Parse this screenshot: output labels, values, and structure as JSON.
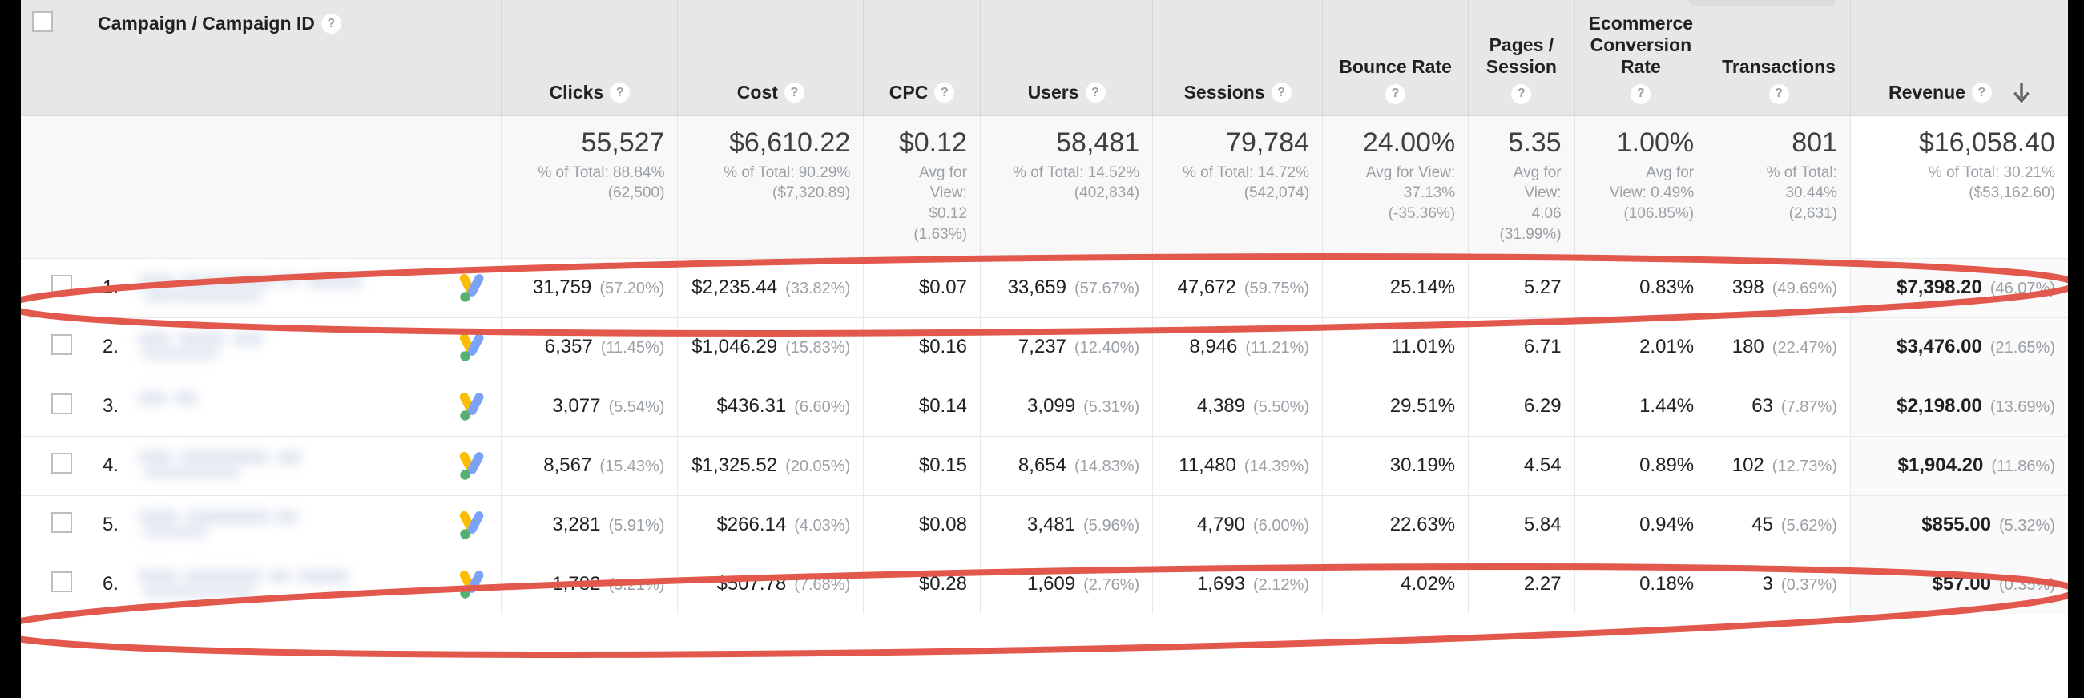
{
  "table": {
    "dimension_header": "Campaign / Campaign ID",
    "help_glyph": "?",
    "sort_arrow_name": "descending-sort-arrow",
    "columns": [
      {
        "key": "clicks",
        "label": "Clicks",
        "help": "?"
      },
      {
        "key": "cost",
        "label": "Cost",
        "help": "?"
      },
      {
        "key": "cpc",
        "label": "CPC",
        "help": "?"
      },
      {
        "key": "users",
        "label": "Users",
        "help": "?"
      },
      {
        "key": "sessions",
        "label": "Sessions",
        "help": "?"
      },
      {
        "key": "bounce",
        "label": "Bounce Rate",
        "help": "?"
      },
      {
        "key": "pages",
        "label": "Pages /\nSession",
        "help": "?"
      },
      {
        "key": "ecom",
        "label": "Ecommerce\nConversion\nRate",
        "help": "?"
      },
      {
        "key": "trans",
        "label": "Transactions",
        "help": "?"
      },
      {
        "key": "revenue",
        "label": "Revenue",
        "help": "?"
      }
    ],
    "summary": {
      "clicks": {
        "value": "55,527",
        "sub": "% of Total: 88.84%\n(62,500)"
      },
      "cost": {
        "value": "$6,610.22",
        "sub": "% of Total: 90.29%\n($7,320.89)"
      },
      "cpc": {
        "value": "$0.12",
        "sub": "Avg for\nView:\n$0.12\n(1.63%)"
      },
      "users": {
        "value": "58,481",
        "sub": "% of Total: 14.52%\n(402,834)"
      },
      "sessions": {
        "value": "79,784",
        "sub": "% of Total: 14.72%\n(542,074)"
      },
      "bounce": {
        "value": "24.00%",
        "sub": "Avg for View:\n37.13%\n(-35.36%)"
      },
      "pages": {
        "value": "5.35",
        "sub": "Avg for\nView:\n4.06\n(31.99%)"
      },
      "ecom": {
        "value": "1.00%",
        "sub": "Avg for\nView: 0.49%\n(106.85%)"
      },
      "trans": {
        "value": "801",
        "sub": "% of Total:\n30.44%\n(2,631)"
      },
      "revenue": {
        "value": "$16,058.40",
        "sub": "% of Total: 30.21%\n($53,162.60)"
      }
    },
    "rows": [
      {
        "index": "1.",
        "campaign_name_redacted": true,
        "clicks": "31,759",
        "clicks_pct": "(57.20%)",
        "cost": "$2,235.44",
        "cost_pct": "(33.82%)",
        "cpc": "$0.07",
        "cpc_pct": "",
        "users": "33,659",
        "users_pct": "(57.67%)",
        "sessions": "47,672",
        "sessions_pct": "(59.75%)",
        "bounce": "25.14%",
        "bounce_pct": "",
        "pages": "5.27",
        "pages_pct": "",
        "ecom": "0.83%",
        "ecom_pct": "",
        "trans": "398",
        "trans_pct": "(49.69%)",
        "revenue": "$7,398.20",
        "revenue_pct": "(46.07%)"
      },
      {
        "index": "2.",
        "campaign_name_redacted": true,
        "clicks": "6,357",
        "clicks_pct": "(11.45%)",
        "cost": "$1,046.29",
        "cost_pct": "(15.83%)",
        "cpc": "$0.16",
        "cpc_pct": "",
        "users": "7,237",
        "users_pct": "(12.40%)",
        "sessions": "8,946",
        "sessions_pct": "(11.21%)",
        "bounce": "11.01%",
        "bounce_pct": "",
        "pages": "6.71",
        "pages_pct": "",
        "ecom": "2.01%",
        "ecom_pct": "",
        "trans": "180",
        "trans_pct": "(22.47%)",
        "revenue": "$3,476.00",
        "revenue_pct": "(21.65%)"
      },
      {
        "index": "3.",
        "campaign_name_redacted": true,
        "clicks": "3,077",
        "clicks_pct": "(5.54%)",
        "cost": "$436.31",
        "cost_pct": "(6.60%)",
        "cpc": "$0.14",
        "cpc_pct": "",
        "users": "3,099",
        "users_pct": "(5.31%)",
        "sessions": "4,389",
        "sessions_pct": "(5.50%)",
        "bounce": "29.51%",
        "bounce_pct": "",
        "pages": "6.29",
        "pages_pct": "",
        "ecom": "1.44%",
        "ecom_pct": "",
        "trans": "63",
        "trans_pct": "(7.87%)",
        "revenue": "$2,198.00",
        "revenue_pct": "(13.69%)"
      },
      {
        "index": "4.",
        "campaign_name_redacted": true,
        "clicks": "8,567",
        "clicks_pct": "(15.43%)",
        "cost": "$1,325.52",
        "cost_pct": "(20.05%)",
        "cpc": "$0.15",
        "cpc_pct": "",
        "users": "8,654",
        "users_pct": "(14.83%)",
        "sessions": "11,480",
        "sessions_pct": "(14.39%)",
        "bounce": "30.19%",
        "bounce_pct": "",
        "pages": "4.54",
        "pages_pct": "",
        "ecom": "0.89%",
        "ecom_pct": "",
        "trans": "102",
        "trans_pct": "(12.73%)",
        "revenue": "$1,904.20",
        "revenue_pct": "(11.86%)"
      },
      {
        "index": "5.",
        "campaign_name_redacted": true,
        "clicks": "3,281",
        "clicks_pct": "(5.91%)",
        "cost": "$266.14",
        "cost_pct": "(4.03%)",
        "cpc": "$0.08",
        "cpc_pct": "",
        "users": "3,481",
        "users_pct": "(5.96%)",
        "sessions": "4,790",
        "sessions_pct": "(6.00%)",
        "bounce": "22.63%",
        "bounce_pct": "",
        "pages": "5.84",
        "pages_pct": "",
        "ecom": "0.94%",
        "ecom_pct": "",
        "trans": "45",
        "trans_pct": "(5.62%)",
        "revenue": "$855.00",
        "revenue_pct": "(5.32%)"
      },
      {
        "index": "6.",
        "campaign_name_redacted": true,
        "clicks": "1,782",
        "clicks_pct": "(3.21%)",
        "cost": "$507.78",
        "cost_pct": "(7.68%)",
        "cpc": "$0.28",
        "cpc_pct": "",
        "users": "1,609",
        "users_pct": "(2.76%)",
        "sessions": "1,693",
        "sessions_pct": "(2.12%)",
        "bounce": "4.02%",
        "bounce_pct": "",
        "pages": "2.27",
        "pages_pct": "",
        "ecom": "0.18%",
        "ecom_pct": "",
        "trans": "3",
        "trans_pct": "(0.37%)",
        "revenue": "$57.00",
        "revenue_pct": "(0.35%)"
      }
    ]
  },
  "annotations": {
    "color": "#e2584d",
    "shapes": [
      {
        "name": "highlight-ellipse-row-1",
        "target_row": "1."
      },
      {
        "name": "highlight-ellipse-row-6",
        "target_row": "6."
      }
    ]
  },
  "colors": {
    "header_bg": "#e7e7e7",
    "summary_bg": "#f8f8f8",
    "sorted_col_bg": "#fafafa",
    "text": "#202124",
    "muted_text": "#9aa0a6",
    "annotation_red": "#e2584d",
    "ads_blue": "#4285f4",
    "ads_yellow": "#fbbc04",
    "ads_green": "#34a853"
  }
}
